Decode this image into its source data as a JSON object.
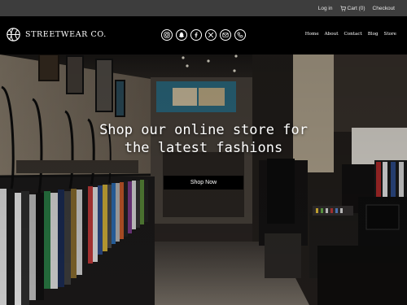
{
  "topbar": {
    "login_label": "Log in",
    "cart_label": "Cart (0)",
    "checkout_label": "Checkout"
  },
  "brand": {
    "name": "STREETWEAR CO.",
    "icon": "basketball-icon"
  },
  "social": [
    {
      "icon": "instagram-icon"
    },
    {
      "icon": "snapchat-icon"
    },
    {
      "icon": "facebook-icon"
    },
    {
      "icon": "x-icon"
    },
    {
      "icon": "email-icon"
    },
    {
      "icon": "phone-icon"
    }
  ],
  "nav": {
    "items": [
      {
        "label": "Home"
      },
      {
        "label": "About"
      },
      {
        "label": "Contact"
      },
      {
        "label": "Blog"
      },
      {
        "label": "Store"
      }
    ]
  },
  "hero": {
    "headline_line1": "Shop our online store for",
    "headline_line2": "the latest fashions",
    "cta_label": "Shop Now"
  },
  "colors": {
    "topbar_bg": "#3d3d3d",
    "header_bg": "#000000",
    "button_bg": "#000000",
    "text": "#ffffff"
  }
}
